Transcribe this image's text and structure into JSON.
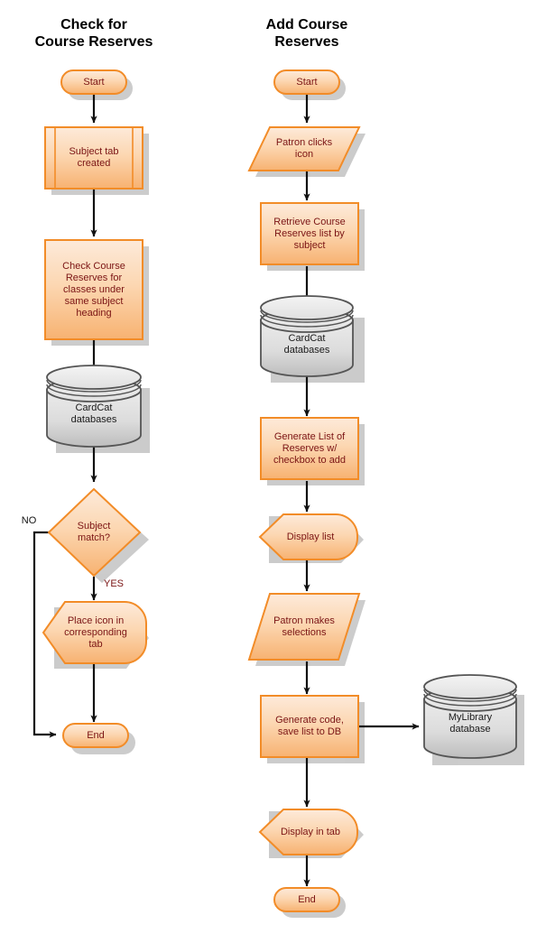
{
  "diagram": {
    "title_left": "Check for\nCourse Reserves",
    "title_right": "Add Course\nReserves",
    "colors": {
      "node_fill_top": "#fde4cc",
      "node_fill_bottom": "#f8b878",
      "node_stroke": "#f28c28",
      "node_text": "#7a1414",
      "db_fill_top": "#e8e8e8",
      "db_fill_bottom": "#c4c4c4",
      "db_stroke": "#555555",
      "db_text": "#1a1a1a",
      "shadow": "#c9c9c9",
      "edge": "#000000",
      "title_text": "#000000"
    }
  },
  "flows": [
    {
      "name": "check-for-course-reserves",
      "title": "Check for\nCourse Reserves",
      "nodes": [
        {
          "id": "l-start",
          "label": "Start",
          "shape": "terminator"
        },
        {
          "id": "l-subject",
          "label": "Subject tab\ncreated",
          "shape": "predefined-process"
        },
        {
          "id": "l-check",
          "label": "Check Course\nReserves for\nclasses under\nsame subject\nheading",
          "shape": "process"
        },
        {
          "id": "l-cardcat",
          "label": "CardCat\ndatabases",
          "shape": "database"
        },
        {
          "id": "l-decision",
          "label": "Subject\nmatch?",
          "shape": "decision"
        },
        {
          "id": "l-place",
          "label": "Place icon in\ncorresponding\ntab",
          "shape": "display"
        },
        {
          "id": "l-end",
          "label": "End",
          "shape": "terminator"
        }
      ],
      "edges": [
        {
          "from": "l-start",
          "to": "l-subject",
          "label": ""
        },
        {
          "from": "l-subject",
          "to": "l-check",
          "label": ""
        },
        {
          "from": "l-check",
          "to": "l-cardcat",
          "label": ""
        },
        {
          "from": "l-cardcat",
          "to": "l-decision",
          "label": ""
        },
        {
          "from": "l-decision",
          "to": "l-end",
          "label": "NO"
        },
        {
          "from": "l-decision",
          "to": "l-place",
          "label": "YES"
        },
        {
          "from": "l-place",
          "to": "l-end",
          "label": ""
        }
      ]
    },
    {
      "name": "add-course-reserves",
      "title": "Add Course\nReserves",
      "nodes": [
        {
          "id": "r-start",
          "label": "Start",
          "shape": "terminator"
        },
        {
          "id": "r-patron",
          "label": "Patron clicks\nicon",
          "shape": "data"
        },
        {
          "id": "r-retrieve",
          "label": "Retrieve Course\nReserves list by\nsubject",
          "shape": "process"
        },
        {
          "id": "r-cardcat",
          "label": "CardCat\ndatabases",
          "shape": "database"
        },
        {
          "id": "r-generate",
          "label": "Generate List of\nReserves w/\ncheckbox to add",
          "shape": "process"
        },
        {
          "id": "r-display",
          "label": "Display list",
          "shape": "display"
        },
        {
          "id": "r-select",
          "label": "Patron makes\nselections",
          "shape": "data"
        },
        {
          "id": "r-code",
          "label": "Generate code,\nsave list to DB",
          "shape": "process"
        },
        {
          "id": "r-mylib",
          "label": "MyLibrary\ndatabase",
          "shape": "database"
        },
        {
          "id": "r-displaytab",
          "label": "Display in tab",
          "shape": "display"
        },
        {
          "id": "r-end",
          "label": "End",
          "shape": "terminator"
        }
      ],
      "edges": [
        {
          "from": "r-start",
          "to": "r-patron",
          "label": ""
        },
        {
          "from": "r-patron",
          "to": "r-retrieve",
          "label": ""
        },
        {
          "from": "r-retrieve",
          "to": "r-cardcat",
          "label": ""
        },
        {
          "from": "r-cardcat",
          "to": "r-generate",
          "label": ""
        },
        {
          "from": "r-generate",
          "to": "r-display",
          "label": ""
        },
        {
          "from": "r-display",
          "to": "r-select",
          "label": ""
        },
        {
          "from": "r-select",
          "to": "r-code",
          "label": ""
        },
        {
          "from": "r-code",
          "to": "r-mylib",
          "label": ""
        },
        {
          "from": "r-code",
          "to": "r-displaytab",
          "label": ""
        },
        {
          "from": "r-displaytab",
          "to": "r-end",
          "label": ""
        }
      ]
    }
  ],
  "labels": {
    "title_left": "Check for\nCourse Reserves",
    "title_right": "Add Course\nReserves",
    "l_start": "Start",
    "l_subject": "Subject tab\ncreated",
    "l_check": "Check Course\nReserves for\nclasses under\nsame subject\nheading",
    "l_cardcat": "CardCat\ndatabases",
    "l_decision": "Subject\nmatch?",
    "l_no": "NO",
    "l_yes": "YES",
    "l_place": "Place icon in\ncorresponding\ntab",
    "l_end": "End",
    "r_start": "Start",
    "r_patron": "Patron clicks\nicon",
    "r_retrieve": "Retrieve Course\nReserves list by\nsubject",
    "r_cardcat": "CardCat\ndatabases",
    "r_generate": "Generate List of\nReserves w/\ncheckbox to add",
    "r_display": "Display list",
    "r_select": "Patron makes\nselections",
    "r_code": "Generate code,\nsave list to DB",
    "r_mylib": "MyLibrary\ndatabase",
    "r_displaytab": "Display in tab",
    "r_end": "End"
  }
}
